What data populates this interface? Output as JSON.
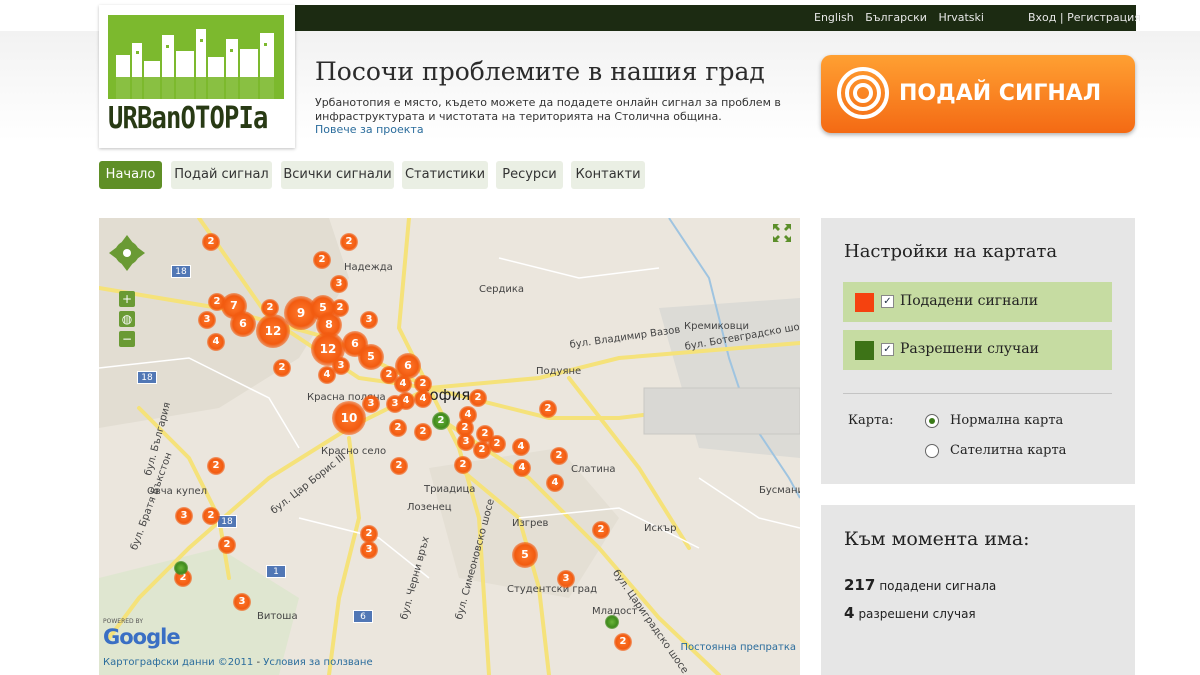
{
  "topbar": {
    "languages": [
      "English",
      "Български",
      "Hrvatski"
    ],
    "login": "Вход",
    "separator": " | ",
    "register": "Регистрация"
  },
  "logo": {
    "text": "URBanOTOPIa",
    "color": "#7cb92e"
  },
  "header": {
    "title": "Посочи проблемите в нашия град",
    "description": "Урбанотопия е място, където можете да подадете онлайн сигнал за проблем в инфраструктурата и чистотата на територията на Столична община.",
    "more_link": "Повече за проекта"
  },
  "report_button": {
    "label": "ПОДАЙ СИГНАЛ",
    "color": "#f46a14"
  },
  "nav": {
    "items": [
      "Начало",
      "Подай сигнал",
      "Всички сигнали",
      "Статистики",
      "Ресурси",
      "Контакти"
    ],
    "active_index": 0
  },
  "map": {
    "city_label": "София",
    "labels": [
      "Надежда",
      "Сердика",
      "Кремиковци",
      "бул. Владимир Вазов",
      "бул. Ботевградско шосе",
      "Подуяне",
      "Красна поляна",
      "Красно село",
      "София",
      "Слатина",
      "Овча купел",
      "Триадица",
      "Лозенец",
      "Изгрев",
      "Искър",
      "Бусмани",
      "Витоша",
      "Студентски град",
      "Младост",
      "бул. Цар Борис III",
      "бул. България",
      "бул. Черни връх",
      "бул. Симеоновско шосе",
      "бул. Цариградско шосе",
      "бул. Братя Бъкстон"
    ],
    "road_shields": [
      "18",
      "18",
      "18",
      "1",
      "6"
    ],
    "markers": [
      "2",
      "2",
      "2",
      "3",
      "2",
      "2",
      "7",
      "2",
      "9",
      "5",
      "3",
      "6",
      "12",
      "8",
      "3",
      "4",
      "12",
      "6",
      "5",
      "2",
      "4",
      "3",
      "6",
      "2",
      "2",
      "4",
      "4",
      "4",
      "2",
      "3",
      "10",
      "3",
      "4",
      "2",
      "3",
      "2",
      "2",
      "2",
      "2",
      "2",
      "4",
      "2",
      "2",
      "4",
      "4",
      "2",
      "2",
      "2",
      "3",
      "2",
      "2",
      "2",
      "3",
      "2",
      "3",
      "5",
      "2",
      "3",
      "2"
    ],
    "green_markers": [
      "2"
    ],
    "powered_by": "POWERED BY",
    "google": "Google",
    "credit": "Картографски данни ©2011",
    "credit_sep": " - ",
    "terms": "Условия за ползване",
    "permalink": "Постоянна препратка"
  },
  "settings": {
    "title": "Настройки на картата",
    "layers": [
      {
        "label": "Подадени сигнали",
        "color": "#f5420f",
        "checked": true
      },
      {
        "label": "Разрешени случаи",
        "color": "#3d7317",
        "checked": true
      }
    ],
    "map_label": "Карта:",
    "map_types": [
      {
        "label": "Нормална карта",
        "selected": true
      },
      {
        "label": "Сателитна карта",
        "selected": false
      }
    ]
  },
  "stats": {
    "title": "Към момента има:",
    "reported_count": "217",
    "reported_label": "подадени сигнала",
    "resolved_count": "4",
    "resolved_label": "разрешени случая"
  }
}
